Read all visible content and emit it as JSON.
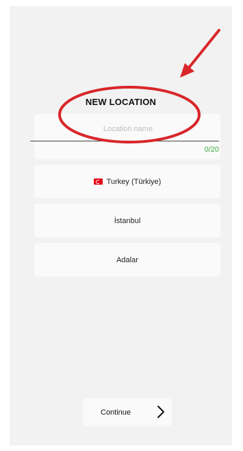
{
  "screen": {
    "title": "NEW LOCATION",
    "name_field": {
      "placeholder": "Location name",
      "value": "",
      "counter": "0/20"
    },
    "country": {
      "label": "Turkey (Türkiye)",
      "flag_icon": "turkey-flag-icon"
    },
    "city": {
      "label": "İstanbul"
    },
    "district": {
      "label": "Adalar"
    },
    "continue_button": {
      "label": "Continue",
      "icon": "chevron-right-icon"
    }
  },
  "annotation": {
    "color": "#d8262a",
    "shapes": [
      "arrow",
      "ellipse"
    ]
  },
  "colors": {
    "counter": "#3cb043",
    "background": "#f2f2f2",
    "card": "#fafafa"
  }
}
